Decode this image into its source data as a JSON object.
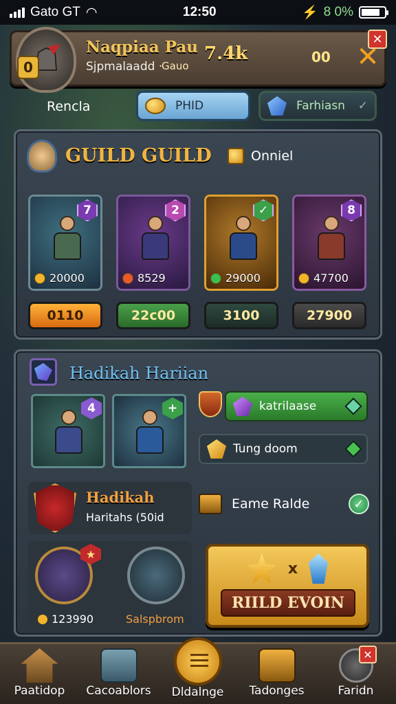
{
  "status": {
    "carrier": "Gato GT",
    "time": "12:50",
    "battery": "8 0%"
  },
  "profile": {
    "badge": "0",
    "name": "Naqpiaa Pau",
    "subtitle": "Sjpmalaadd ·",
    "sub2": "Gauo",
    "power": "7.4k",
    "count": "00"
  },
  "nav": {
    "label": "Rencla",
    "guild_btn": "PHID",
    "fav_btn": "Farhiasn"
  },
  "guild": {
    "title": "GUILD GUILD",
    "online_label": "Onniel",
    "heroes": [
      {
        "level": "7",
        "value": "20000",
        "button": "0110",
        "theme": "teal"
      },
      {
        "level": "2",
        "value": "8529",
        "button": "22c00",
        "theme": "purple"
      },
      {
        "level": "✓",
        "value": "29000",
        "button": "3100",
        "theme": "gold"
      },
      {
        "level": "8",
        "value": "47700",
        "button": "27900",
        "theme": "violet"
      }
    ]
  },
  "daily": {
    "title": "Hadikah Hariian",
    "cards": [
      {
        "level": "4"
      },
      {
        "level": "+"
      }
    ],
    "slots": [
      {
        "label": "katrilaase"
      },
      {
        "label": "Tung doom"
      }
    ],
    "reward": {
      "title": "Hadikah",
      "subtitle": "Haritahs (50id"
    },
    "event": {
      "label": "Eame Ralde"
    },
    "bottom_value": "123990",
    "bottom_name": "Salspbrom",
    "action": {
      "multiplier": "x",
      "label": "RIILD EVOIN"
    }
  },
  "bottom_nav": [
    {
      "label": "Paatidop"
    },
    {
      "label": "Cacoablors"
    },
    {
      "label": "Dldalnge"
    },
    {
      "label": "Tadonges"
    },
    {
      "label": "Faridn"
    }
  ],
  "colors": {
    "accent": "#f0b440",
    "panel": "#3a4651",
    "blue": "#6fc0f2"
  }
}
